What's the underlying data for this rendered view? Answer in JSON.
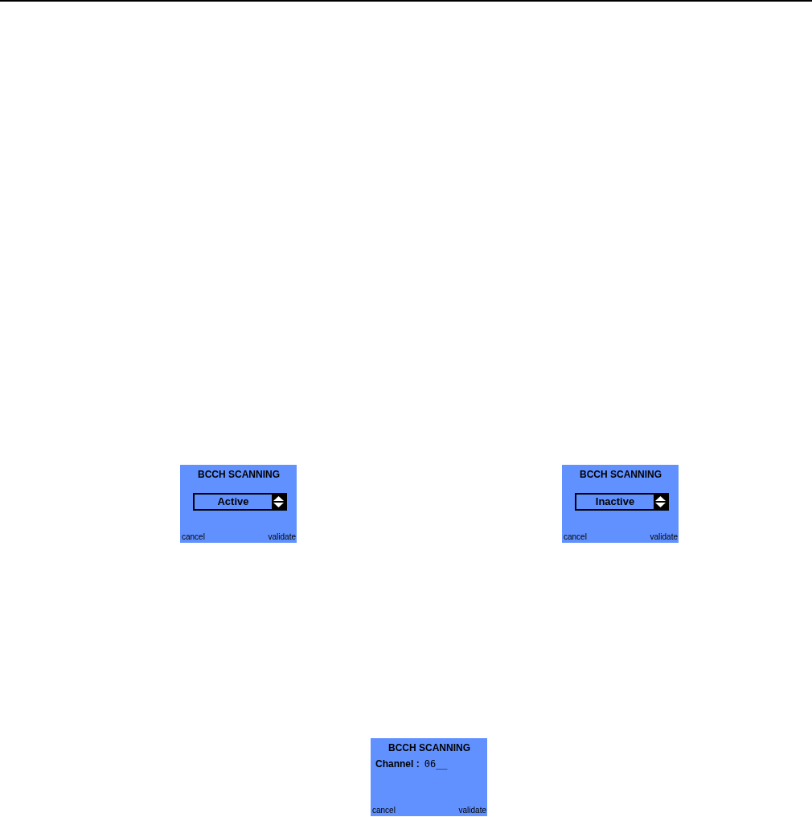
{
  "rows": [
    {
      "screens": [
        {
          "kind": "selector",
          "title": "BCCH SCANNING",
          "value": "Active",
          "softkeys": [
            "cancel",
            "validate"
          ]
        },
        {
          "kind": "selector",
          "title": "BCCH SCANNING",
          "value": "Inactive",
          "softkeys": [
            "cancel",
            "validate"
          ]
        }
      ]
    },
    {
      "screens": [
        {
          "kind": "entry",
          "title": "BCCH SCANNING",
          "label": "Channel :",
          "value": "06__",
          "softkeys": [
            "cancel",
            "validate"
          ]
        }
      ]
    }
  ]
}
